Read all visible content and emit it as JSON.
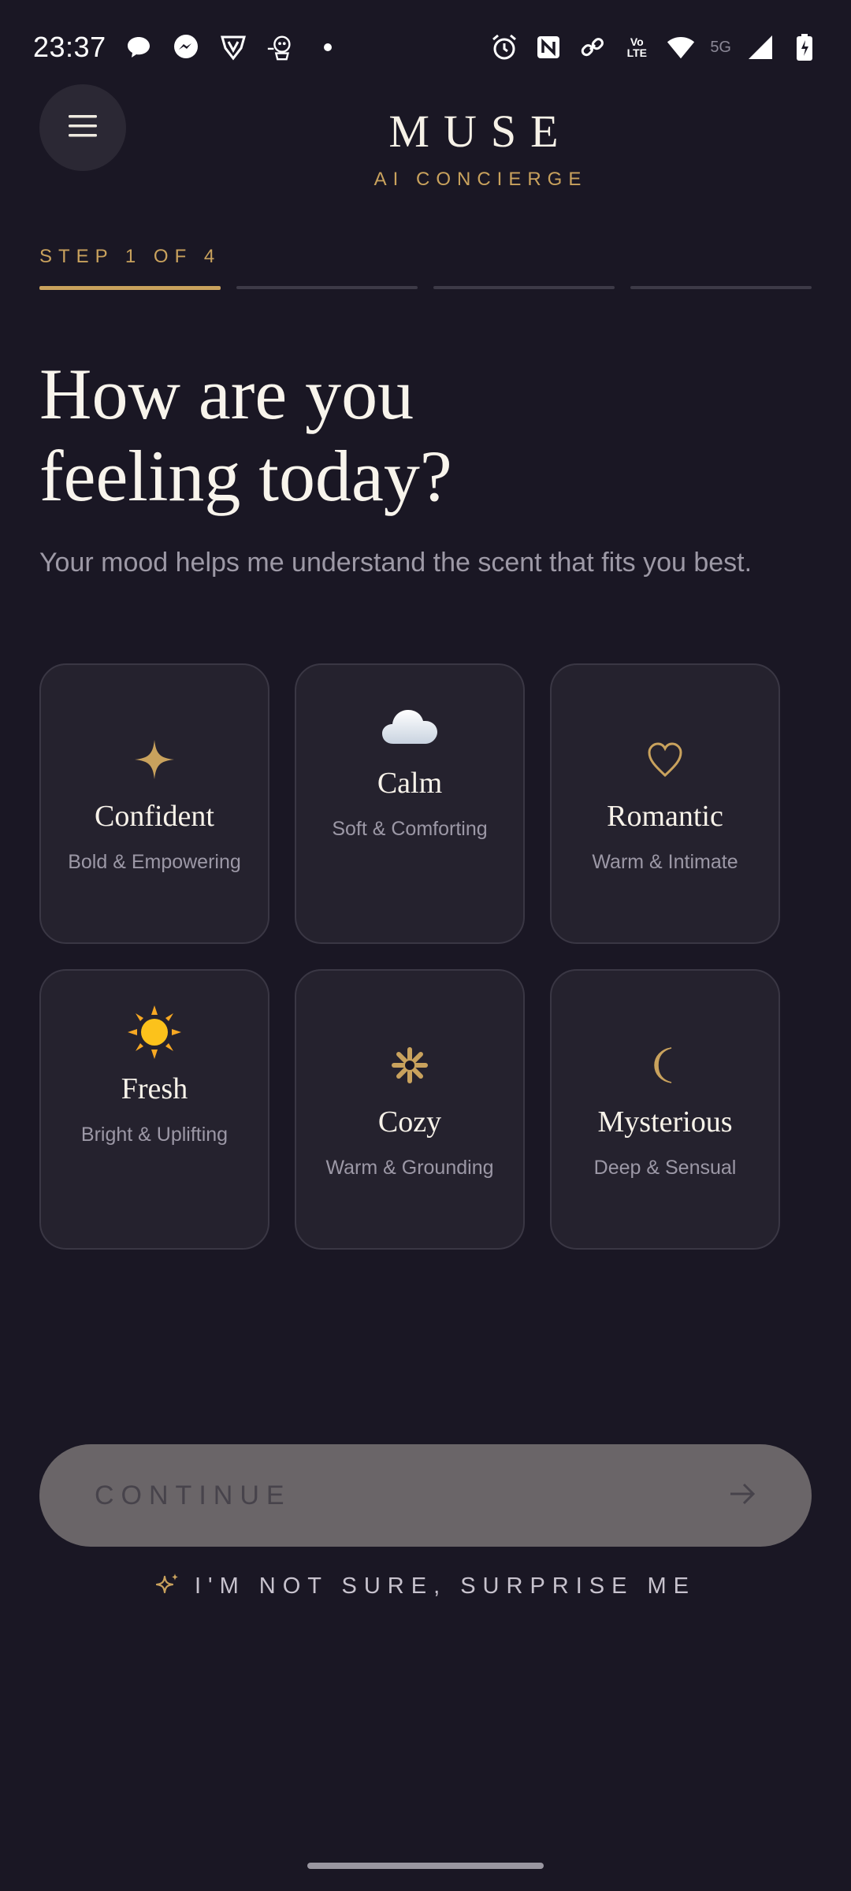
{
  "status_bar": {
    "time": "23:37",
    "left_icons": [
      "chat-bubble-icon",
      "messenger-icon",
      "shield-v-icon",
      "mascot-icon",
      "dot-icon"
    ],
    "right_icons": [
      "alarm-icon",
      "nfc-icon",
      "link-icon",
      "volte-icon",
      "wifi-icon",
      "signal-icon",
      "battery-icon"
    ],
    "volte_text": "Vo LTE",
    "network": "5G"
  },
  "header": {
    "brand_title": "MUSE",
    "brand_subtitle": "AI CONCIERGE"
  },
  "progress": {
    "step_label": "STEP 1 OF 4",
    "current": 1,
    "total": 4
  },
  "heading": {
    "line1": "How are you",
    "line2": "feeling today?",
    "subtitle": "Your mood helps me understand the scent that fits you best."
  },
  "moods": [
    {
      "title": "Confident",
      "desc": "Bold & Empowering",
      "icon": "four-point-star-icon"
    },
    {
      "title": "Calm",
      "desc": "Soft & Comforting",
      "icon": "cloud-icon"
    },
    {
      "title": "Romantic",
      "desc": "Warm & Intimate",
      "icon": "heart-outline-icon"
    },
    {
      "title": "Fresh",
      "desc": "Bright & Uplifting",
      "icon": "sun-icon"
    },
    {
      "title": "Cozy",
      "desc": "Warm & Grounding",
      "icon": "asterisk-flower-icon"
    },
    {
      "title": "Mysterious",
      "desc": "Deep & Sensual",
      "icon": "crescent-moon-icon"
    }
  ],
  "actions": {
    "continue_label": "CONTINUE",
    "surprise_label": "I'M NOT SURE, SURPRISE ME"
  },
  "colors": {
    "background": "#1a1724",
    "accent_gold": "#c9a25d",
    "card": "#25222e",
    "continue_disabled": "#6a6568"
  }
}
